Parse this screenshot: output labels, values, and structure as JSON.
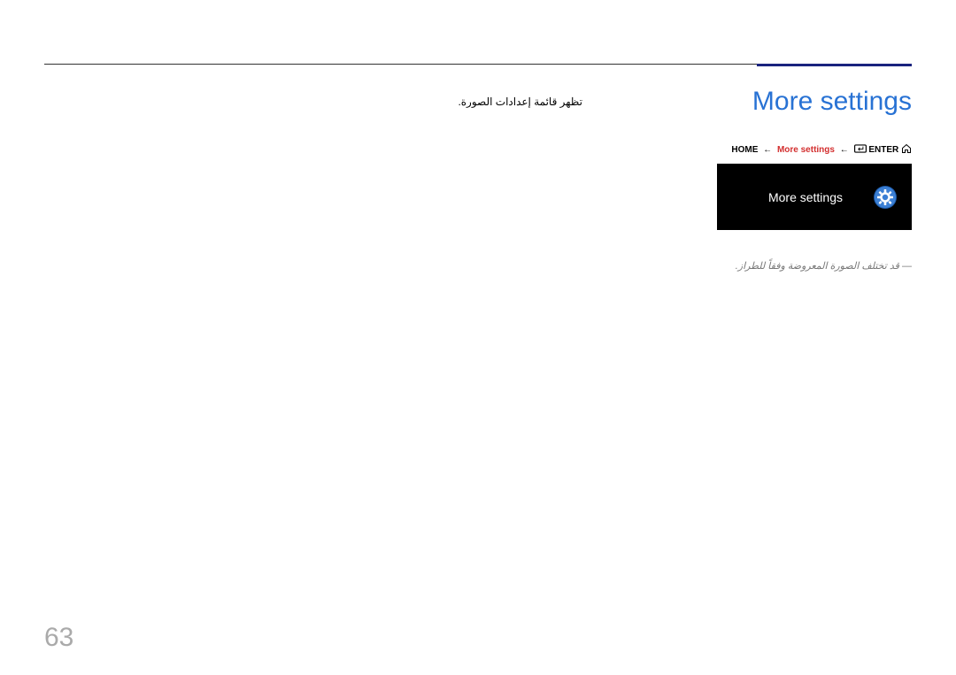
{
  "section_title": "More settings",
  "breadcrumb": {
    "home_label": "HOME",
    "arrow1": "←",
    "more_settings_label": "More settings",
    "arrow2": "←",
    "enter_label": "ENTER"
  },
  "menu_panel": {
    "label": "More settings"
  },
  "description": "تظهر قائمة إعدادات الصورة.",
  "note": "― قد تختلف الصورة المعروضة وفقاً للطراز.",
  "page_number": "63"
}
